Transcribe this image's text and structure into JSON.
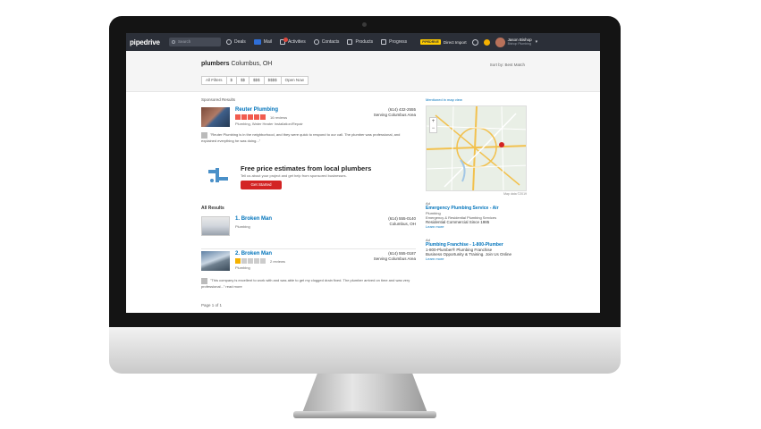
{
  "topbar": {
    "logo": "pipedrive",
    "search_placeholder": "Search",
    "nav": [
      {
        "label": "Deals",
        "icon": "deals-icon"
      },
      {
        "label": "Mail",
        "icon": "mail-icon"
      },
      {
        "label": "Activities",
        "icon": "calendar-icon"
      },
      {
        "label": "Contacts",
        "icon": "contacts-icon"
      },
      {
        "label": "Products",
        "icon": "products-icon"
      },
      {
        "label": "Progress",
        "icon": "progress-icon"
      }
    ],
    "deal_chip": "PIPEDRIVE",
    "deal_text": "Direct Import",
    "user_name": "Jason Bishop",
    "user_company": "Bishop Plumbing"
  },
  "header": {
    "title_bold": "plumbers",
    "title_rest": " Columbus, OH",
    "sort": "Sort by: Best Match",
    "filters": [
      "All Filters",
      "$",
      "$$",
      "$$$",
      "$$$$",
      "Open Now"
    ]
  },
  "main": {
    "sponsored_label": "Sponsored Results",
    "sponsored": {
      "name": "Reuter Plumbing",
      "reviews": "16 reviews",
      "category": "Plumbing, Water Heater Installation/Repair",
      "phone": "(614) 432-2555",
      "area": "Serving Columbus Area",
      "snippet": "\"Reuter Plumbing is in the neighborhood, and they were quick to respond to our call. The plumber was professional, and explained everything he was doing...\""
    },
    "promo": {
      "title": "Free price estimates from local plumbers",
      "subtitle": "Tell us about your project and get help from sponsored businesses.",
      "button": "Get Started"
    },
    "all_results_label": "All Results",
    "results": [
      {
        "index": "1.",
        "name": "Broken Man",
        "category": "Plumbing",
        "phone": "(614) 555-0140",
        "area": "Columbus, OH"
      },
      {
        "index": "2.",
        "name": "Broken Man",
        "reviews": "2 reviews",
        "category": "Plumbing",
        "phone": "(614) 555-0187",
        "area": "Serving Columbus Area",
        "snippet": "\"This company is excellent to work with and was able to get my clogged drain fixed. The plumber arrived on time and was very professional...\" read more"
      }
    ],
    "pagination": "Page 1 of 1"
  },
  "side": {
    "map_link": "Mentioned in map view",
    "map_attrib": "Map data ©2019",
    "ads": [
      {
        "label": "Ad",
        "title": "Emergency Plumbing Service - Air",
        "lines": [
          "Plumbing",
          "Emergency & Residential Plumbing Services",
          "Residential Commercial Since 1985"
        ],
        "link": "Learn more"
      },
      {
        "label": "Ad",
        "title": "Plumbing Franchise - 1-800-Plumber",
        "lines": [
          "1-800-Plumber® Plumbing Franchise",
          "Business Opportunity & Training. Join Us Online"
        ],
        "link": "Learn more"
      }
    ]
  },
  "colors": {
    "topbar_bg": "#2b2f38",
    "link_blue": "#0073bb",
    "brand_red": "#d32323",
    "star_red": "#f15c4f"
  }
}
